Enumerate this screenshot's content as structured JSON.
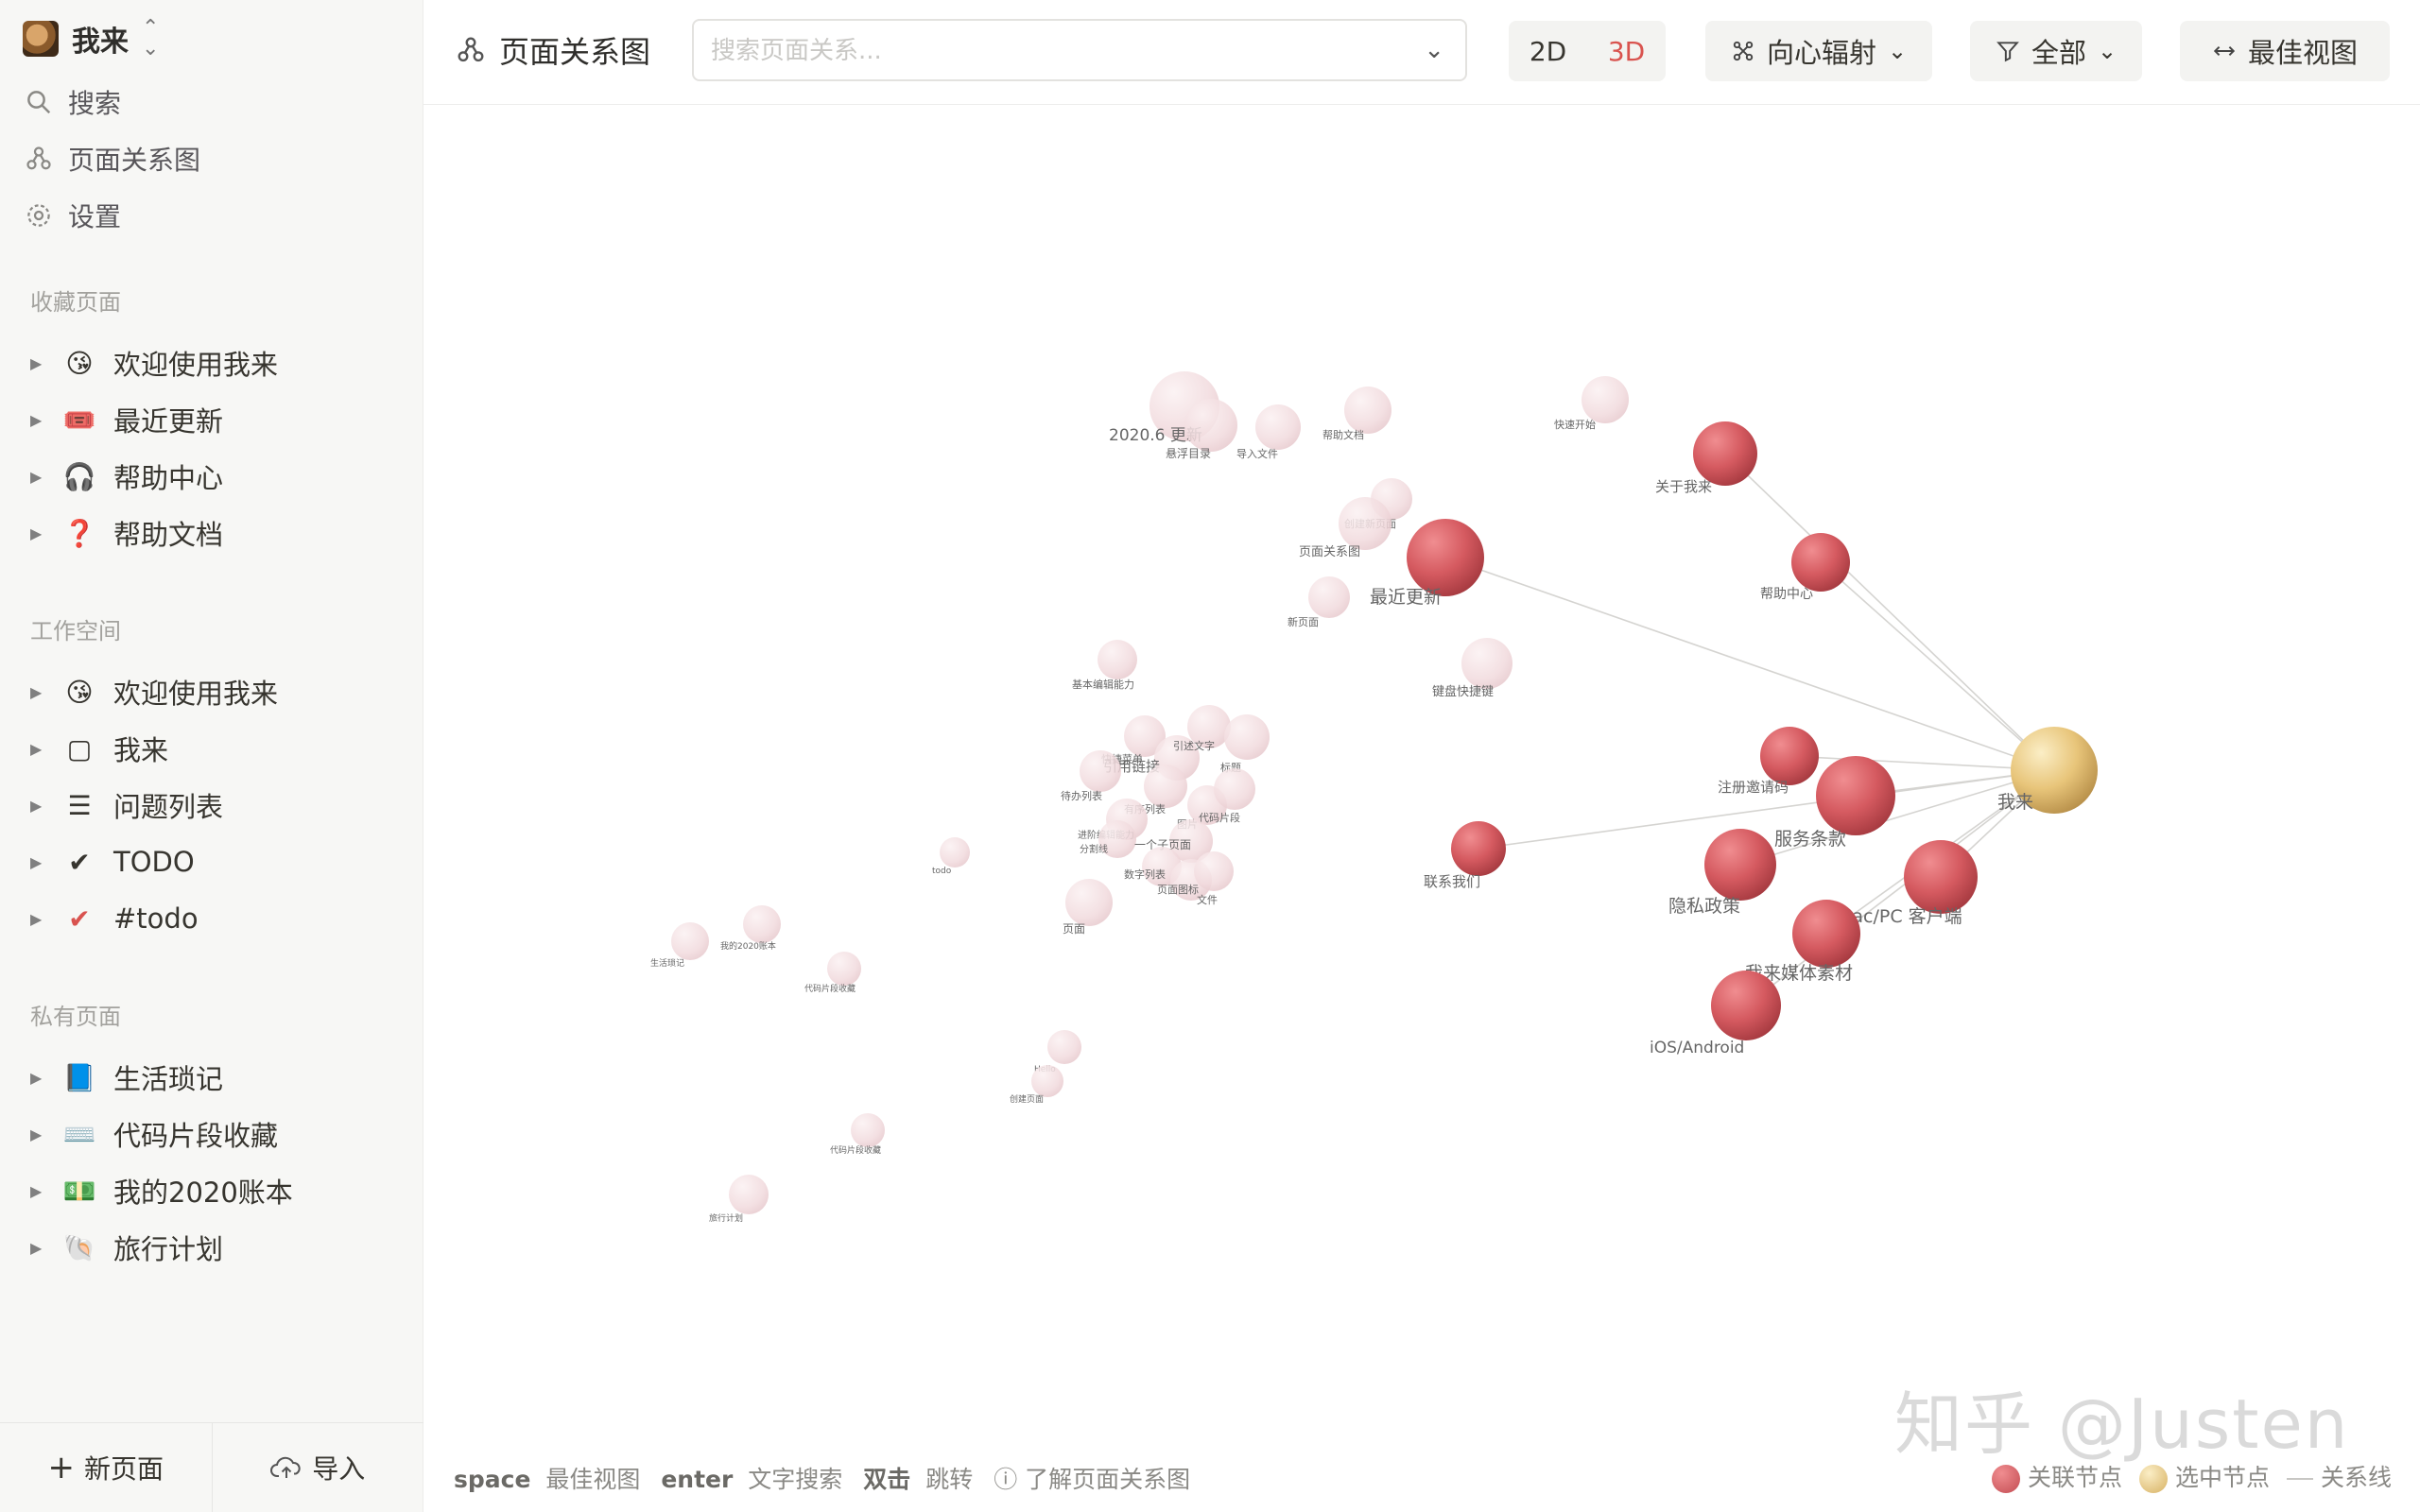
{
  "workspace": {
    "name": "我来"
  },
  "nav": {
    "search": "搜索",
    "graph": "页面关系图",
    "settings": "设置"
  },
  "sections": {
    "favorites": "收藏页面",
    "workspace": "工作空间",
    "private": "私有页面"
  },
  "favorites": [
    {
      "label": "欢迎使用我来",
      "icon": "😘"
    },
    {
      "label": "最近更新",
      "icon": "🎟️"
    },
    {
      "label": "帮助中心",
      "icon": "🎧"
    },
    {
      "label": "帮助文档",
      "icon": "❓"
    }
  ],
  "workspace_items": [
    {
      "label": "欢迎使用我来",
      "icon": "😘"
    },
    {
      "label": "我来",
      "icon": "▢"
    },
    {
      "label": "问题列表",
      "icon": "☰"
    },
    {
      "label": "TODO",
      "icon": "✔"
    },
    {
      "label": "#todo",
      "icon": "✔"
    }
  ],
  "private_items": [
    {
      "label": "生活琐记",
      "icon": "📘"
    },
    {
      "label": "代码片段收藏",
      "icon": "⌨️"
    },
    {
      "label": "我的2020账本",
      "icon": "💵"
    },
    {
      "label": "旅行计划",
      "icon": "🐚"
    }
  ],
  "footer": {
    "new_page": "新页面",
    "import": "导入"
  },
  "toolbar": {
    "title": "页面关系图",
    "search_placeholder": "搜索页面关系...",
    "mode_2d": "2D",
    "mode_3d": "3D",
    "layout": "向心辐射",
    "filter": "全部",
    "best_view": "最佳视图"
  },
  "hints": [
    {
      "key": "space",
      "text": "最佳视图"
    },
    {
      "key": "enter",
      "text": "文字搜索"
    },
    {
      "key": "双击",
      "text": "跳转"
    }
  ],
  "help_link": "了解页面关系图",
  "legend": {
    "related": "关联节点",
    "selected": "选中节点",
    "edge": "关系线"
  },
  "colors": {
    "related": "#d25a5f",
    "selected": "#e5c172",
    "faded": "#f1dadd",
    "accent": "#d9534f"
  },
  "watermark": "知乎 @Justen",
  "graph_labels": {
    "center": "我来",
    "n_about": "关于我来",
    "n_help": "帮助中心",
    "n_recent": "最近更新",
    "n_register": "注册邀请码",
    "n_terms": "服务条款",
    "n_contact": "联系我们",
    "n_privacy": "隐私政策",
    "n_mac": "Mac/PC 客户端",
    "n_media": "我来媒体素材",
    "n_ios": "iOS/Android",
    "f_2020": "2020.6 更新",
    "f_toc": "悬浮目录",
    "f_import": "导入文件",
    "f_helpdoc": "帮助文档",
    "f_quick": "快速开始",
    "f_create": "创建新页面",
    "f_graph": "页面关系图",
    "f_new": "新页面",
    "f_kbd": "键盘快捷键",
    "f_basic": "基本编辑能力",
    "f_quickop": "快捷菜单",
    "f_quote": "引用链接",
    "f_bigtext": "引述文字",
    "f_title": "标题",
    "f_todo": "待办列表",
    "f_ordered": "有序列表",
    "f_image": "图片",
    "f_code": "代码片段",
    "f_more": "进阶编辑能力",
    "f_divider": "分割线",
    "f_subpage": "一个子页面",
    "f_numlist": "数字列表",
    "f_icon": "页面图标",
    "f_file": "文件",
    "f_page": "页面",
    "f_todo2": "todo",
    "f_life": "生活琐记",
    "f_bills": "我的2020账本",
    "f_code2": "代码片段收藏",
    "f_travel": "旅行计划",
    "f_hello": "Hello",
    "f_new2": "创建页面"
  }
}
